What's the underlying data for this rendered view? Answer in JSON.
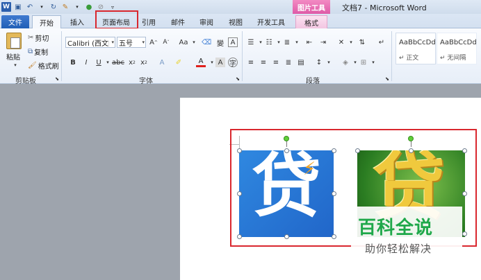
{
  "window": {
    "title": "文档7 - Microsoft Word",
    "context_tab_group": "图片工具"
  },
  "tabs": [
    "文件",
    "开始",
    "插入",
    "页面布局",
    "引用",
    "邮件",
    "审阅",
    "视图",
    "开发工具",
    "格式"
  ],
  "ribbon": {
    "clipboard": {
      "paste": "粘贴",
      "cut": "剪切",
      "copy": "复制",
      "format_painter": "格式刷",
      "label": "剪贴板"
    },
    "font": {
      "font_name": "Calibri (西文[",
      "font_size": "五号",
      "label": "字体"
    },
    "paragraph": {
      "label": "段落"
    },
    "styles": {
      "style1_preview": "AaBbCcDd",
      "style1_name": "↵ 正文",
      "style2_preview": "AaBbCcDd",
      "style2_name": "↵ 无间隔"
    }
  },
  "watermark": {
    "line1": "百科全说",
    "line2": "助你轻松解决"
  },
  "images": {
    "img1_char": "贷",
    "img2_char": "贷"
  },
  "colors": {
    "highlight": "#d9272e",
    "file_tab": "#2a6cc4",
    "picture_tools": "#e066ae"
  }
}
